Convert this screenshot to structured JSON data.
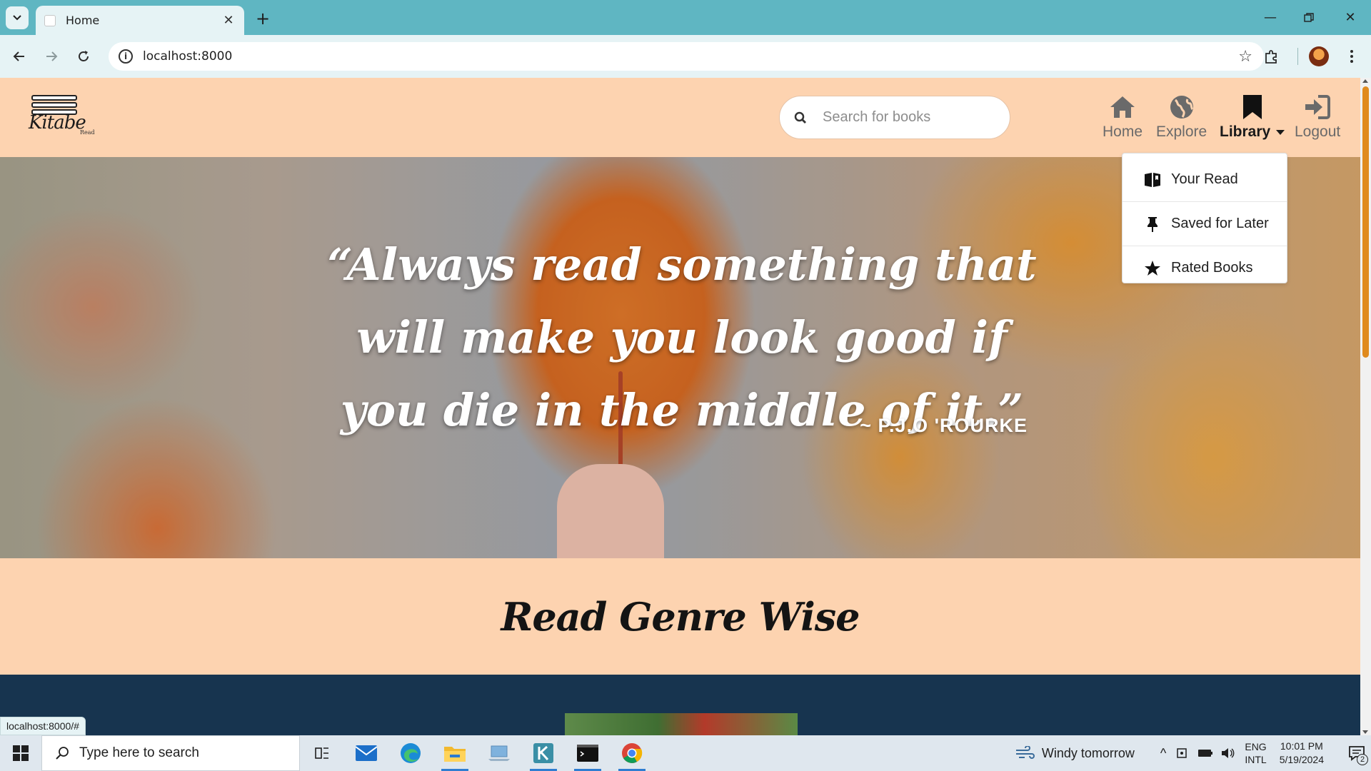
{
  "browser": {
    "tab_title": "Home",
    "url": "localhost:8000",
    "status_url": "localhost:8000/#"
  },
  "site": {
    "logo_text": "Kitabe",
    "logo_sub": "Read",
    "search_placeholder": "Search for books",
    "nav": [
      {
        "label": "Home",
        "icon": "home-icon"
      },
      {
        "label": "Explore",
        "icon": "globe-icon"
      },
      {
        "label": "Library",
        "icon": "bookmark-icon"
      },
      {
        "label": "Logout",
        "icon": "sign-in-icon"
      }
    ],
    "library_menu": [
      {
        "label": "Your Read",
        "icon": "book-open-icon"
      },
      {
        "label": "Saved for Later",
        "icon": "thumbtack-icon"
      },
      {
        "label": "Rated Books",
        "icon": "star-icon"
      }
    ]
  },
  "hero": {
    "quote": "“Always read something that will make you look good if you die in the middle of it.”",
    "author": "~ P.J.O 'ROURKE"
  },
  "genre_section": {
    "title": "Read Genre Wise"
  },
  "taskbar": {
    "search_placeholder": "Type here to search",
    "weather": "Windy tomorrow",
    "language": "ENG",
    "keyboard": "INTL",
    "time": "10:01 PM",
    "date": "5/19/2024",
    "notification_count": "2"
  },
  "colors": {
    "page_bg": "#fdd3b0",
    "browser_frame": "#5fb6c2",
    "dark_section": "#17344f",
    "scroll_thumb": "#e08a1e"
  }
}
